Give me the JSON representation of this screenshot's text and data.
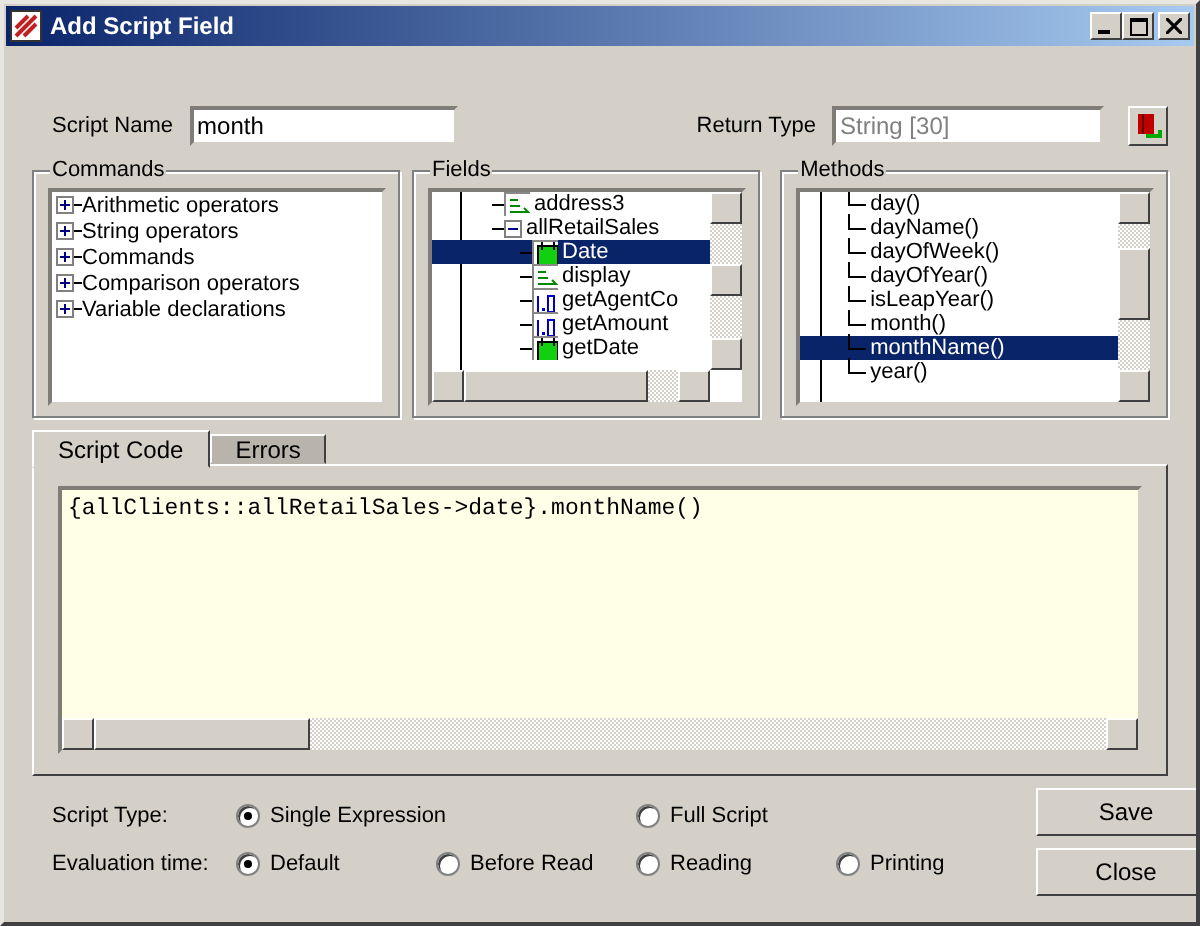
{
  "window": {
    "title": "Add Script Field"
  },
  "script_name": {
    "label": "Script Name",
    "value": "month"
  },
  "return_type": {
    "label": "Return Type",
    "value": "String [30]",
    "disabled": true
  },
  "commands": {
    "title": "Commands",
    "items": [
      {
        "label": "Arithmetic operators",
        "expanded": false
      },
      {
        "label": "String operators",
        "expanded": false
      },
      {
        "label": "Commands",
        "expanded": false
      },
      {
        "label": "Comparison operators",
        "expanded": false
      },
      {
        "label": "Variable declarations",
        "expanded": false
      }
    ]
  },
  "fields": {
    "title": "Fields",
    "items": [
      {
        "label": "address3",
        "kind": "text",
        "selected": false
      },
      {
        "label": "allRetailSales",
        "kind": "group",
        "expanded": true,
        "selected": false,
        "children": [
          {
            "label": "Date",
            "kind": "date",
            "selected": true
          },
          {
            "label": "display",
            "kind": "text",
            "selected": false
          },
          {
            "label": "getAgentCo",
            "kind": "number",
            "selected": false
          },
          {
            "label": "getAmount",
            "kind": "number",
            "selected": false
          },
          {
            "label": "getDate",
            "kind": "date",
            "selected": false
          }
        ]
      }
    ]
  },
  "methods": {
    "title": "Methods",
    "items": [
      {
        "label": "day()",
        "selected": false
      },
      {
        "label": "dayName()",
        "selected": false
      },
      {
        "label": "dayOfWeek()",
        "selected": false
      },
      {
        "label": "dayOfYear()",
        "selected": false
      },
      {
        "label": "isLeapYear()",
        "selected": false
      },
      {
        "label": "month()",
        "selected": false
      },
      {
        "label": "monthName()",
        "selected": true
      },
      {
        "label": "year()",
        "selected": false
      }
    ]
  },
  "tabs": [
    {
      "label": "Script Code",
      "selected": true
    },
    {
      "label": "Errors",
      "selected": false
    }
  ],
  "code": "{allClients::allRetailSales->date}.monthName()",
  "script_type": {
    "label": "Script Type:",
    "options": [
      {
        "label": "Single Expression",
        "selected": true
      },
      {
        "label": "Full Script",
        "selected": false
      }
    ]
  },
  "evaluation_time": {
    "label": "Evaluation time:",
    "options": [
      {
        "label": "Default",
        "selected": true
      },
      {
        "label": "Before Read",
        "selected": false
      },
      {
        "label": "Reading",
        "selected": false
      },
      {
        "label": "Printing",
        "selected": false
      }
    ]
  },
  "buttons": [
    "Save",
    "Close"
  ]
}
